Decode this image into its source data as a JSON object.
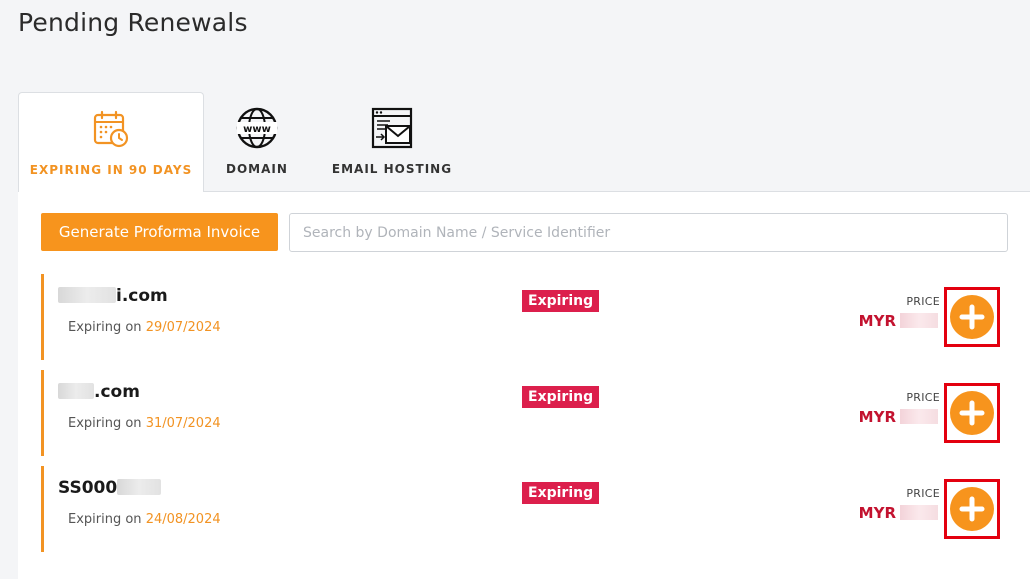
{
  "page": {
    "title": "Pending Renewals"
  },
  "tabs": [
    {
      "label": "EXPIRING IN 90 DAYS",
      "icon": "calendar-clock-icon",
      "active": true
    },
    {
      "label": "DOMAIN",
      "icon": "www-globe-icon",
      "active": false
    },
    {
      "label": "EMAIL HOSTING",
      "icon": "email-envelope-icon",
      "active": false
    }
  ],
  "toolbar": {
    "generate_label": "Generate Proforma Invoice",
    "search_placeholder": "Search by Domain Name / Service Identifier"
  },
  "renewals": [
    {
      "name_suffix": "i.com",
      "expiring_prefix": "Expiring on",
      "date": "29/07/2024",
      "status": "Expiring",
      "price_label": "PRICE",
      "currency": "MYR"
    },
    {
      "name_suffix": ".com",
      "expiring_prefix": "Expiring on",
      "date": "31/07/2024",
      "status": "Expiring",
      "price_label": "PRICE",
      "currency": "MYR"
    },
    {
      "name_prefix": "SS000",
      "expiring_prefix": "Expiring on",
      "date": "24/08/2024",
      "status": "Expiring",
      "price_label": "PRICE",
      "currency": "MYR"
    }
  ],
  "colors": {
    "accent": "#f7941d",
    "badge": "#dc1f4c",
    "price": "#c3122f",
    "highlight_box": "#e3000f"
  }
}
